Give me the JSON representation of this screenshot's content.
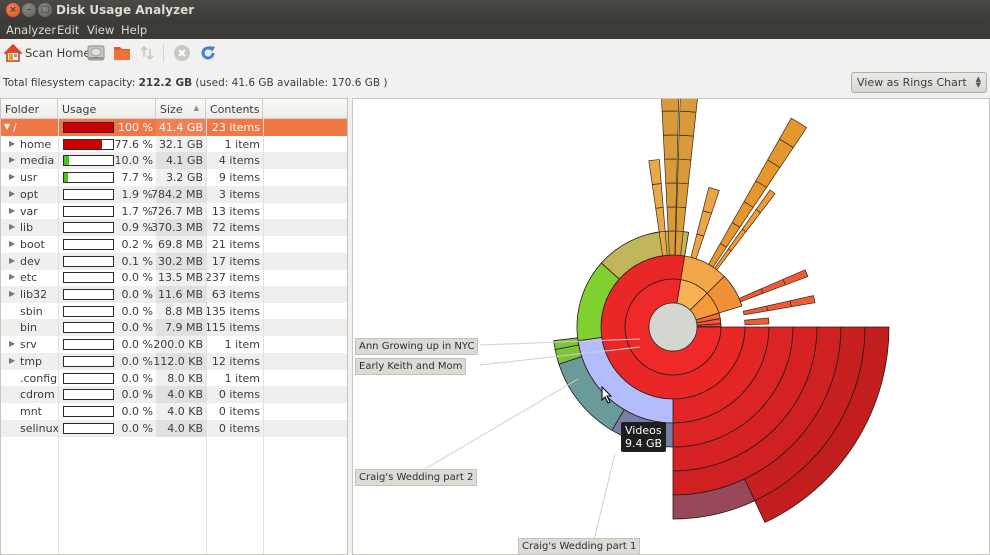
{
  "window": {
    "title": "Disk Usage Analyzer",
    "close_glyph": "×",
    "minimize_glyph": "–",
    "maximize_glyph": "□"
  },
  "menu": [
    "Analyzer",
    "Edit",
    "View",
    "Help"
  ],
  "toolbar": {
    "scan_home_label": "Scan Home",
    "icons": [
      "home-icon",
      "harddisk-icon",
      "folder-icon",
      "remote-icon",
      "stop-icon",
      "refresh-icon"
    ]
  },
  "capacity": {
    "prefix": "Total filesystem capacity: ",
    "total": "212.2 GB",
    "suffix": " (used: 41.6 GB available: 170.6 GB )"
  },
  "view_select": {
    "selected": "View as Rings Chart"
  },
  "tree": {
    "columns": [
      "Folder",
      "Usage",
      "Size",
      "Contents"
    ],
    "sort_indicator": "▲",
    "rows": [
      {
        "name": "/",
        "percent": "100 %",
        "usage": 1.0,
        "bar_color": "#cc0000",
        "size": "41.4 GB",
        "contents": "23 items",
        "expandable": true,
        "expanded": true,
        "selected": true
      },
      {
        "name": "home",
        "percent": "77.6 %",
        "usage": 0.776,
        "bar_color": "#cc0000",
        "size": "32.1 GB",
        "contents": "1 item",
        "expandable": true
      },
      {
        "name": "media",
        "percent": "10.0 %",
        "usage": 0.1,
        "bar_color": "#4ec21a",
        "size": "4.1 GB",
        "contents": "4 items",
        "expandable": true
      },
      {
        "name": "usr",
        "percent": "7.7 %",
        "usage": 0.077,
        "bar_color": "#4ec21a",
        "size": "3.2 GB",
        "contents": "9 items",
        "expandable": true
      },
      {
        "name": "opt",
        "percent": "1.9 %",
        "usage": 0.019,
        "bar_color": "#ffffff",
        "size": "784.2 MB",
        "contents": "3 items",
        "expandable": true
      },
      {
        "name": "var",
        "percent": "1.7 %",
        "usage": 0.017,
        "bar_color": "#ffffff",
        "size": "726.7 MB",
        "contents": "13 items",
        "expandable": true
      },
      {
        "name": "lib",
        "percent": "0.9 %",
        "usage": 0.009,
        "bar_color": "#ffffff",
        "size": "370.3 MB",
        "contents": "72 items",
        "expandable": true
      },
      {
        "name": "boot",
        "percent": "0.2 %",
        "usage": 0.002,
        "bar_color": "#ffffff",
        "size": "69.8 MB",
        "contents": "21 items",
        "expandable": true
      },
      {
        "name": "dev",
        "percent": "0.1 %",
        "usage": 0.001,
        "bar_color": "#ffffff",
        "size": "30.2 MB",
        "contents": "17 items",
        "expandable": true
      },
      {
        "name": "etc",
        "percent": "0.0 %",
        "usage": 0.0,
        "bar_color": "#ffffff",
        "size": "13.5 MB",
        "contents": "237 items",
        "expandable": true
      },
      {
        "name": "lib32",
        "percent": "0.0 %",
        "usage": 0.0,
        "bar_color": "#ffffff",
        "size": "11.6 MB",
        "contents": "63 items",
        "expandable": true
      },
      {
        "name": "sbin",
        "percent": "0.0 %",
        "usage": 0.0,
        "bar_color": "#ffffff",
        "size": "8.8 MB",
        "contents": "135 items",
        "expandable": false
      },
      {
        "name": "bin",
        "percent": "0.0 %",
        "usage": 0.0,
        "bar_color": "#ffffff",
        "size": "7.9 MB",
        "contents": "115 items",
        "expandable": false
      },
      {
        "name": "srv",
        "percent": "0.0 %",
        "usage": 0.0,
        "bar_color": "#ffffff",
        "size": "200.0 KB",
        "contents": "1 item",
        "expandable": true
      },
      {
        "name": "tmp",
        "percent": "0.0 %",
        "usage": 0.0,
        "bar_color": "#ffffff",
        "size": "112.0 KB",
        "contents": "12 items",
        "expandable": true
      },
      {
        "name": ".config",
        "percent": "0.0 %",
        "usage": 0.0,
        "bar_color": "#ffffff",
        "size": "8.0 KB",
        "contents": "1 item",
        "expandable": false
      },
      {
        "name": "cdrom",
        "percent": "0.0 %",
        "usage": 0.0,
        "bar_color": "#ffffff",
        "size": "4.0 KB",
        "contents": "0 items",
        "expandable": false
      },
      {
        "name": "mnt",
        "percent": "0.0 %",
        "usage": 0.0,
        "bar_color": "#ffffff",
        "size": "4.0 KB",
        "contents": "0 items",
        "expandable": false
      },
      {
        "name": "selinux",
        "percent": "0.0 %",
        "usage": 0.0,
        "bar_color": "#ffffff",
        "size": "4.0 KB",
        "contents": "0 items",
        "expandable": false
      }
    ]
  },
  "rings_chart": {
    "labels": [
      "Ann Growing up in NYC",
      "Early Keith and Mom",
      "Craig's Wedding part 2",
      "Craig's Wedding part 1"
    ],
    "tooltip": {
      "name": "Videos",
      "size": "9.4 GB"
    },
    "center_color": "#d3d7cf"
  },
  "chart_data": {
    "type": "rings",
    "title": "",
    "root": "/",
    "center_color": "#d3d7cf",
    "segments": [
      {
        "name": "home",
        "depth": 1,
        "start_frac": 0.0,
        "frac": 0.776,
        "color": "#ef2929"
      },
      {
        "name": "home/*",
        "depth": 2,
        "start_frac": 0.0,
        "frac": 0.776,
        "color": "#ea2727"
      },
      {
        "name": "home/*/*",
        "depth": 3,
        "start_frac": 0.0,
        "frac": 0.25,
        "color": "#e22525"
      },
      {
        "name": "Videos",
        "depth": 3,
        "start_frac": 0.25,
        "frac": 0.227,
        "color": "#b4bdfb"
      },
      {
        "name": "home/*/* (other)",
        "depth": 3,
        "start_frac": 0.477,
        "frac": 0.139,
        "color": "#80d02f"
      },
      {
        "name": "home/*/* (other 2)",
        "depth": 3,
        "start_frac": 0.616,
        "frac": 0.16,
        "color": "#c1b55a"
      },
      {
        "name": "depth4-a",
        "depth": 4,
        "start_frac": 0.0,
        "frac": 0.25,
        "color": "#dc2424"
      },
      {
        "name": "Craig's Wedding part 1",
        "depth": 4,
        "start_frac": 0.25,
        "frac": 0.085,
        "color": "#7a7fa9"
      },
      {
        "name": "Craig's Wedding part 2",
        "depth": 4,
        "start_frac": 0.335,
        "frac": 0.115,
        "color": "#6a9a99"
      },
      {
        "name": "Early Keith and Mom",
        "depth": 4,
        "start_frac": 0.45,
        "frac": 0.02,
        "color": "#7dc43a"
      },
      {
        "name": "Ann Growing up in NYC",
        "depth": 4,
        "start_frac": 0.47,
        "frac": 0.012,
        "color": "#7dc43a"
      },
      {
        "name": "depth5-a",
        "depth": 5,
        "start_frac": 0.0,
        "frac": 0.25,
        "color": "#d62222"
      },
      {
        "name": "depth6-a",
        "depth": 6,
        "start_frac": 0.0,
        "frac": 0.25,
        "color": "#cf2121"
      },
      {
        "name": "depth7-a",
        "depth": 7,
        "start_frac": 0.0,
        "frac": 0.18,
        "color": "#c82020"
      },
      {
        "name": "depth7-b",
        "depth": 7,
        "start_frac": 0.18,
        "frac": 0.07,
        "color": "#98485a"
      },
      {
        "name": "depth8-a",
        "depth": 8,
        "start_frac": 0.0,
        "frac": 0.18,
        "color": "#c21e1e"
      },
      {
        "name": "media",
        "depth": 1,
        "start_frac": 0.776,
        "frac": 0.1,
        "color": "#f7b155"
      },
      {
        "name": "usr",
        "depth": 1,
        "start_frac": 0.876,
        "frac": 0.077,
        "color": "#f59a3c"
      },
      {
        "name": "opt",
        "depth": 1,
        "start_frac": 0.953,
        "frac": 0.019,
        "color": "#ef6b3c"
      },
      {
        "name": "var",
        "depth": 1,
        "start_frac": 0.972,
        "frac": 0.017,
        "color": "#ef5a3c"
      },
      {
        "name": "lib",
        "depth": 1,
        "start_frac": 0.989,
        "frac": 0.009,
        "color": "#ef4a3c"
      }
    ]
  }
}
